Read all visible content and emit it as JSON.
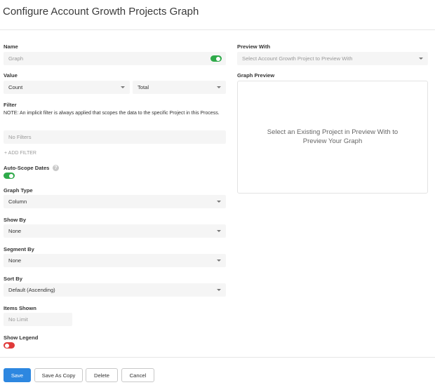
{
  "page": {
    "title": "Configure Account Growth Projects Graph"
  },
  "form": {
    "name": {
      "label": "Name",
      "value": "Graph",
      "toggle_on": true,
      "toggle_color": "#2faa4a"
    },
    "value": {
      "label": "Value",
      "aggregate": "Count",
      "field": "Total"
    },
    "filter": {
      "label": "Filter",
      "note": "NOTE: An implicit filter is always applied that scopes the data to the specific Project in this Process.",
      "placeholder": "No Filters",
      "add_label": "+ ADD FILTER"
    },
    "auto_scope": {
      "label": "Auto-Scope Dates",
      "help_glyph": "?",
      "toggle_on": true
    },
    "graph_type": {
      "label": "Graph Type",
      "value": "Column"
    },
    "show_by": {
      "label": "Show By",
      "value": "None"
    },
    "segment_by": {
      "label": "Segment By",
      "value": "None"
    },
    "sort_by": {
      "label": "Sort By",
      "value": "Default (Ascending)"
    },
    "items_shown": {
      "label": "Items Shown",
      "placeholder": "No Limit"
    },
    "show_legend": {
      "label": "Show Legend",
      "toggle_on": false,
      "toggle_color": "#e03a3a"
    }
  },
  "preview": {
    "with_label": "Preview With",
    "select_placeholder": "Select Account Growth Project to Preview With",
    "graph_label": "Graph Preview",
    "message": "Select an Existing Project in Preview With to Preview Your Graph"
  },
  "actions": {
    "save": "Save",
    "save_as_copy": "Save As Copy",
    "delete": "Delete",
    "cancel": "Cancel",
    "primary_color": "#2d87e0"
  }
}
